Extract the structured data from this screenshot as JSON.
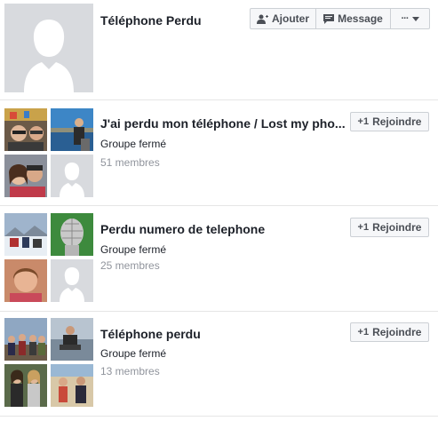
{
  "profile": {
    "name": "Téléphone Perdu",
    "add_label": "Ajouter",
    "message_label": "Message",
    "more_label": "···"
  },
  "groups": [
    {
      "name": "J'ai perdu mon téléphone / Lost my pho...",
      "privacy": "Groupe fermé",
      "members": "51 membres",
      "join_label": "Rejoindre"
    },
    {
      "name": "Perdu numero de telephone",
      "privacy": "Groupe fermé",
      "members": "25 membres",
      "join_label": "Rejoindre"
    },
    {
      "name": "Téléphone perdu",
      "privacy": "Groupe fermé",
      "members": "13 membres",
      "join_label": "Rejoindre"
    }
  ],
  "colors": {
    "placeholder_bg": "#d8dade",
    "button_bg": "#f6f7f9",
    "button_border": "#ccd0d5",
    "meta_text": "#90949c"
  },
  "icons": [
    "add-friend-icon",
    "message-icon",
    "more-icon",
    "dropdown-arrow-icon",
    "join-plus-one-icon",
    "default-profile-silhouette-icon"
  ]
}
